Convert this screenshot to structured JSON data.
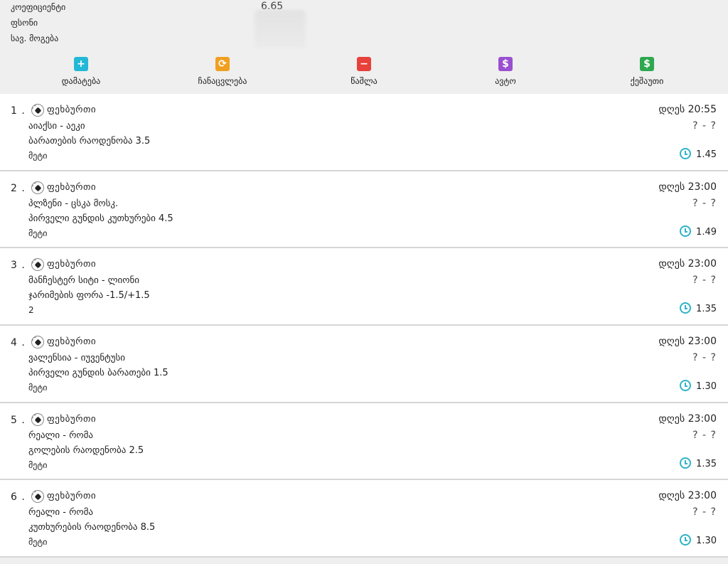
{
  "summary": {
    "coefficient_label": "კოეფიციენტი",
    "coefficient_value": "6.65",
    "price_label": "ფსონი",
    "payout_label": "სავ. მოგება"
  },
  "actions": [
    {
      "label": "დამატება",
      "icon": "plus-icon",
      "glyph": "+",
      "color": "#22b8d6"
    },
    {
      "label": "ჩანაცვლება",
      "icon": "refresh-icon",
      "glyph": "⟳",
      "color": "#f0a020"
    },
    {
      "label": "წაშლა",
      "icon": "minus-icon",
      "glyph": "−",
      "color": "#e8403a"
    },
    {
      "label": "ავტო",
      "icon": "dollar-icon",
      "glyph": "$",
      "color": "#9a4fd0"
    },
    {
      "label": "ქეშაუთი",
      "icon": "dollar-icon",
      "glyph": "$",
      "color": "#2ea84f"
    }
  ],
  "bets": [
    {
      "num": "1 .",
      "sport": "ფეხბურთი",
      "match": "აიაქსი - აეკი",
      "market": "ბარათების რაოდენობა 3.5",
      "pick": "მეტი",
      "time": "დღეს 20:55",
      "score": "? - ?",
      "odd": "1.45"
    },
    {
      "num": "2 .",
      "sport": "ფეხბურთი",
      "match": "პლზენი - ცსკა მოსკ.",
      "market": "პირველი გუნდის კუთხურები 4.5",
      "pick": "მეტი",
      "time": "დღეს 23:00",
      "score": "? - ?",
      "odd": "1.49"
    },
    {
      "num": "3 .",
      "sport": "ფეხბურთი",
      "match": "მანჩესტერ სიტი - ლიონი",
      "market": "ჯარიმების ფორა -1.5/+1.5",
      "pick": "2",
      "time": "დღეს 23:00",
      "score": "? - ?",
      "odd": "1.35"
    },
    {
      "num": "4 .",
      "sport": "ფეხბურთი",
      "match": "ვალენსია - იუვენტუსი",
      "market": "პირველი გუნდის ბარათები 1.5",
      "pick": "მეტი",
      "time": "დღეს 23:00",
      "score": "? - ?",
      "odd": "1.30"
    },
    {
      "num": "5 .",
      "sport": "ფეხბურთი",
      "match": "რეალი - რომა",
      "market": "გოლების რაოდენობა 2.5",
      "pick": "მეტი",
      "time": "დღეს 23:00",
      "score": "? - ?",
      "odd": "1.35"
    },
    {
      "num": "6 .",
      "sport": "ფეხბურთი",
      "match": "რეალი - რომა",
      "market": "კუთხურების რაოდენობა 8.5",
      "pick": "მეტი",
      "time": "დღეს 23:00",
      "score": "? - ?",
      "odd": "1.30"
    }
  ]
}
